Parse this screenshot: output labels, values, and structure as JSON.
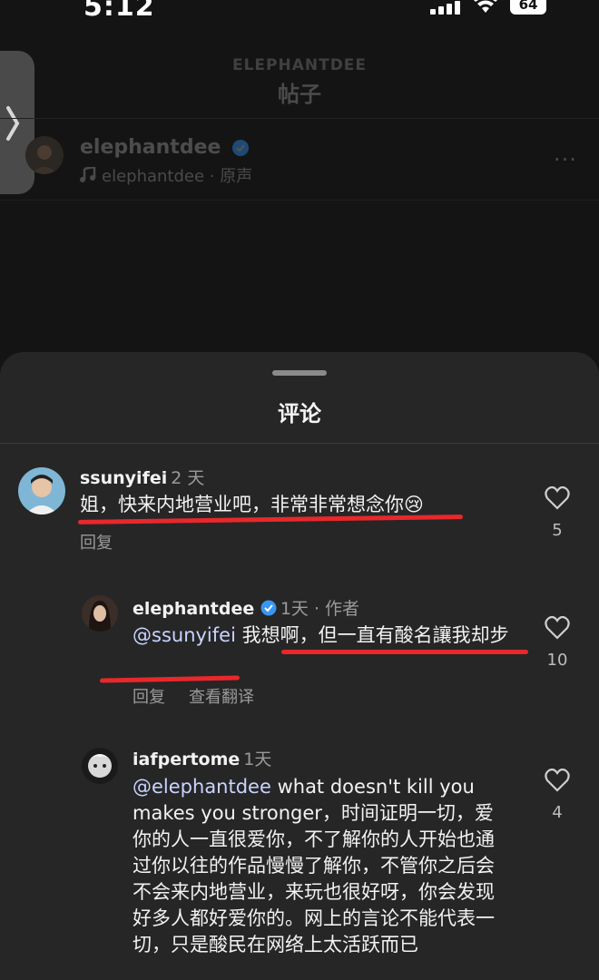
{
  "status_bar": {
    "time": "5:12",
    "battery": "64"
  },
  "post_header": {
    "account": "ELEPHANTDEE",
    "title": "帖子",
    "username": "elephantdee",
    "audio": "elephantdee · 原声",
    "more": "···"
  },
  "sheet": {
    "title": "评论"
  },
  "comments": [
    {
      "username": "ssunyifei",
      "time": "2 天",
      "text": "姐，快来内地营业吧，非常非常想念你😢",
      "reply": "回复",
      "likes": "5"
    },
    {
      "username": "elephantdee",
      "time": "1天 · 作者",
      "mention": "@ssunyifei",
      "text": " 我想啊，但一直有酸名讓我却步",
      "reply": "回复",
      "translate": "查看翻译",
      "likes": "10"
    },
    {
      "username": "iafpertome",
      "time": "1天",
      "mention": "@elephantdee",
      "text": " what doesn't kill you makes you stronger，时间证明一切，爱你的人一直很爱你，不了解你的人开始也通过你以往的作品慢慢了解你，不管你之后会不会来内地营业，来玩也很好呀，你会发现好多人都好爱你的。网上的言论不能代表一切，只是酸民在网络上太活跃而已",
      "likes": "4"
    }
  ],
  "colors": {
    "underline": "#e8282b",
    "verified": "#3897f0",
    "sheet_bg": "#262626"
  }
}
